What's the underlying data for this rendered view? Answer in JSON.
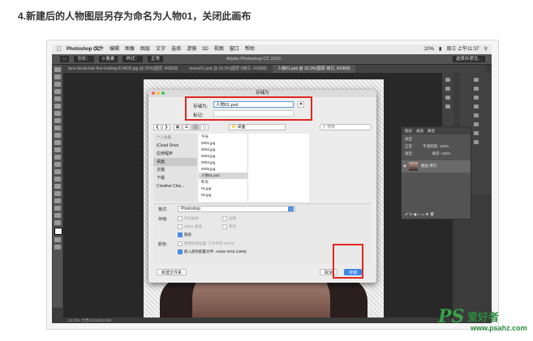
{
  "heading": "4.新建后的人物图层另存为命名为人物01，关闭此画布",
  "mac_menubar": {
    "app": "Photoshop CC",
    "menus": [
      "文件",
      "编辑",
      "图像",
      "图层",
      "文字",
      "选择",
      "滤镜",
      "3D",
      "视图",
      "窗口",
      "帮助"
    ],
    "battery": "20%",
    "time": "周三 上午11:37"
  },
  "ps_title": "Adobe Photoshop CC 2019",
  "options_bar": {
    "tool_label": "羽化：",
    "feather": "0 像素",
    "style_label": "样式：",
    "style": "正常",
    "select_mask": "选择并遮住..."
  },
  "doc_tabs": [
    "face-facial-hair-fine-looking-614830.jpg @ 25%(图层, RGB/8)",
    "renwu01.psd @ 33.3%(图层 0拷贝, RGB/8)",
    "人物01.psd @ 33.3%(图层 拷贝, RGB/8)"
  ],
  "dialog": {
    "title": "存储为",
    "save_as_label": "存储为:",
    "filename": "人物01.psd",
    "tags_label": "标记:",
    "location": "桌面",
    "search_placeholder": "搜索",
    "sidebar_header": "个人收藏",
    "sidebar": [
      "iCloud Drive",
      "应用程序",
      "桌面",
      "文稿",
      "下载",
      "Creative Clou..."
    ],
    "col1": [
      "今天",
      "0001.jpg",
      "0002.jpg",
      "0003.jpg",
      "0004.jpg",
      "0005.jpg",
      "人物01.psd",
      "昨天",
      "01.jpg",
      "02.jpg"
    ],
    "format_label": "格式:",
    "format": "Photoshop",
    "save_label": "存储:",
    "color_label": "颜色:",
    "opt_copy": "作为副本",
    "opt_notes": "注释",
    "opt_alpha": "Alpha 通道",
    "opt_spot": "专色",
    "opt_layers": "图层",
    "opt_proof": "使用校样设置: 工作中的 CMYK",
    "opt_icc": "嵌入颜色配置文件: Adobe RGB (1998)",
    "new_folder": "新建文件夹",
    "cancel": "取消",
    "save": "存储"
  },
  "layers_panel": {
    "tabs": [
      "图层",
      "通道",
      "路径"
    ],
    "kind": "类型",
    "blend": "正常",
    "opacity_label": "不透明度:",
    "opacity": "100%",
    "lock_label": "锁定:",
    "fill_label": "填充:",
    "fill": "100%",
    "layer_name": "图层 拷贝"
  },
  "status": "33.33%   文档:53.0M/53.0M",
  "watermark": {
    "ps": "PS",
    "cn": "爱好者",
    "url": "www.psahz.com"
  },
  "colors": {
    "accent": "#3e86e6",
    "highlight": "#e0271f",
    "ps_gray": "#3b3b3b"
  }
}
